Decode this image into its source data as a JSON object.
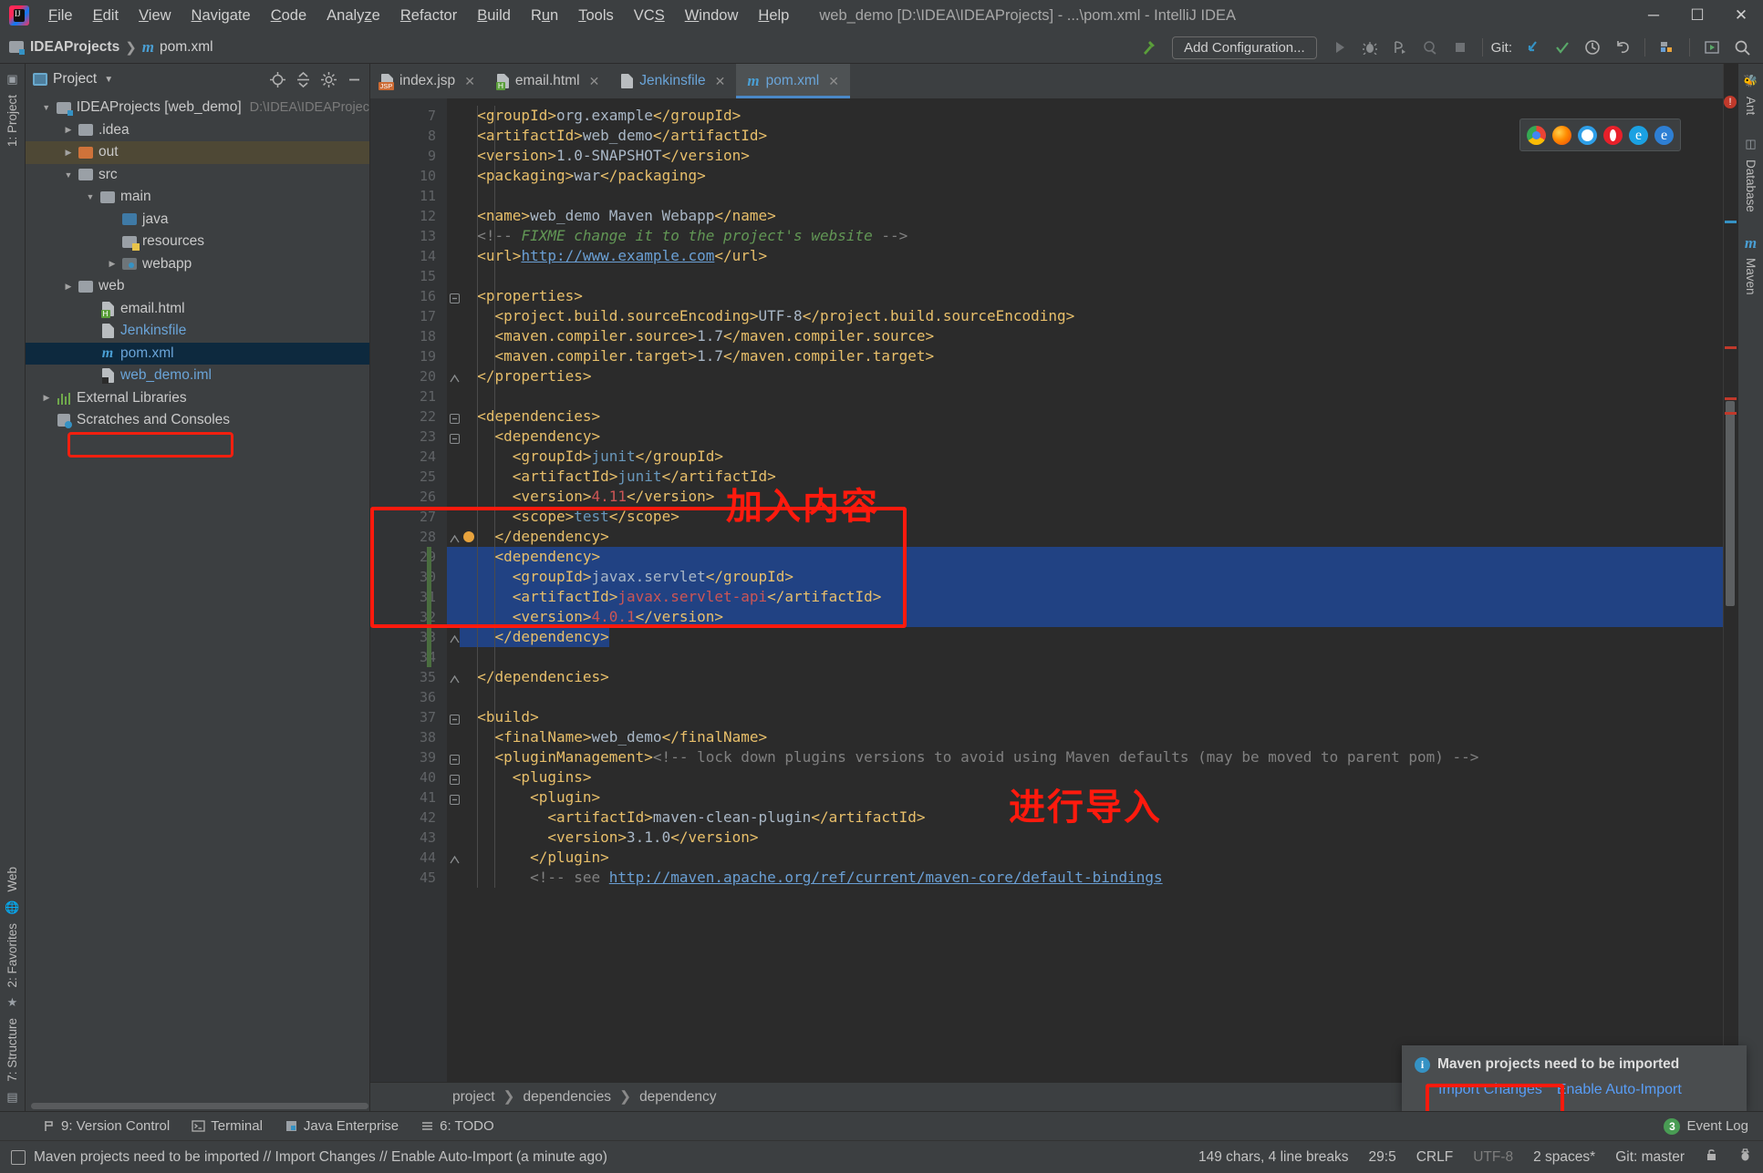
{
  "window": {
    "title": "web_demo [D:\\IDEA\\IDEAProjects] - ...\\pom.xml - IntelliJ IDEA",
    "minimize": "─",
    "maximize": "☐",
    "close": "✕"
  },
  "menu": [
    {
      "label": "File",
      "mnemonic": "F"
    },
    {
      "label": "Edit",
      "mnemonic": "E"
    },
    {
      "label": "View",
      "mnemonic": "V"
    },
    {
      "label": "Navigate",
      "mnemonic": "N"
    },
    {
      "label": "Code",
      "mnemonic": "C"
    },
    {
      "label": "Analyze",
      "mnemonic": "z"
    },
    {
      "label": "Refactor",
      "mnemonic": "R"
    },
    {
      "label": "Build",
      "mnemonic": "B"
    },
    {
      "label": "Run",
      "mnemonic": "u"
    },
    {
      "label": "Tools",
      "mnemonic": "T"
    },
    {
      "label": "VCS",
      "mnemonic": "S"
    },
    {
      "label": "Window",
      "mnemonic": "W"
    },
    {
      "label": "Help",
      "mnemonic": "H"
    }
  ],
  "navbar": {
    "crumb_project": "IDEAProjects",
    "crumb_file": "pom.xml",
    "add_configuration": "Add Configuration...",
    "git_label": "Git:"
  },
  "project_panel": {
    "title": "Project",
    "tree": [
      {
        "label": "IDEAProjects [web_demo]",
        "path": "D:\\IDEA\\IDEAProjec",
        "indent": 0,
        "arrow": "▼",
        "icon": "folder-root",
        "state": "normal"
      },
      {
        "label": ".idea",
        "path": "",
        "indent": 1,
        "arrow": "▶",
        "icon": "folder",
        "state": "normal"
      },
      {
        "label": "out",
        "path": "",
        "indent": 1,
        "arrow": "▶",
        "icon": "folder-orange",
        "state": "highlight"
      },
      {
        "label": "src",
        "path": "",
        "indent": 1,
        "arrow": "▼",
        "icon": "folder",
        "state": "normal"
      },
      {
        "label": "main",
        "path": "",
        "indent": 2,
        "arrow": "▼",
        "icon": "folder",
        "state": "normal"
      },
      {
        "label": "java",
        "path": "",
        "indent": 3,
        "arrow": "",
        "icon": "folder-blue",
        "state": "normal"
      },
      {
        "label": "resources",
        "path": "",
        "indent": 3,
        "arrow": "",
        "icon": "folder-resources",
        "state": "normal"
      },
      {
        "label": "webapp",
        "path": "",
        "indent": 3,
        "arrow": "▶",
        "icon": "folder-webapp",
        "state": "normal"
      },
      {
        "label": "web",
        "path": "",
        "indent": 1,
        "arrow": "▶",
        "icon": "folder",
        "state": "normal"
      },
      {
        "label": "email.html",
        "path": "",
        "indent": 2,
        "arrow": "",
        "icon": "file-html",
        "state": "normal"
      },
      {
        "label": "Jenkinsfile",
        "path": "",
        "indent": 2,
        "arrow": "",
        "icon": "file-jenkins",
        "state": "blue"
      },
      {
        "label": "pom.xml",
        "path": "",
        "indent": 2,
        "arrow": "",
        "icon": "file-maven",
        "state": "selected"
      },
      {
        "label": "web_demo.iml",
        "path": "",
        "indent": 2,
        "arrow": "",
        "icon": "file-iml",
        "state": "blue"
      },
      {
        "label": "External Libraries",
        "path": "",
        "indent": 0,
        "arrow": "▶",
        "icon": "libraries",
        "state": "normal"
      },
      {
        "label": "Scratches and Consoles",
        "path": "",
        "indent": 0,
        "arrow": "",
        "icon": "scratches",
        "state": "normal"
      }
    ]
  },
  "left_strip": {
    "project": "1: Project",
    "web": "Web",
    "favorites": "2: Favorites",
    "structure": "7: Structure"
  },
  "right_strip": {
    "ant": "Ant",
    "database": "Database",
    "maven": "Maven"
  },
  "tabs": [
    {
      "label": "index.jsp",
      "icon": "jsp-icon",
      "active": false
    },
    {
      "label": "email.html",
      "icon": "html-icon",
      "active": false
    },
    {
      "label": "Jenkinsfile",
      "icon": "jenkins-icon",
      "active": false
    },
    {
      "label": "pom.xml",
      "icon": "maven-icon",
      "active": true
    }
  ],
  "code": {
    "first_line": 7,
    "lines": [
      {
        "n": 7,
        "html": "  <span class='tg'>&lt;groupId&gt;</span><span class='tx'>org.example</span><span class='tg'>&lt;/groupId&gt;</span>"
      },
      {
        "n": 8,
        "html": "  <span class='tg'>&lt;artifactId&gt;</span><span class='tx'>web_demo</span><span class='tg'>&lt;/artifactId&gt;</span>"
      },
      {
        "n": 9,
        "html": "  <span class='tg'>&lt;version&gt;</span><span class='tx'>1.0-SNAPSHOT</span><span class='tg'>&lt;/version&gt;</span>"
      },
      {
        "n": 10,
        "html": "  <span class='tg'>&lt;packaging&gt;</span><span class='tx'>war</span><span class='tg'>&lt;/packaging&gt;</span>"
      },
      {
        "n": 11,
        "html": ""
      },
      {
        "n": 12,
        "html": "  <span class='tg'>&lt;name&gt;</span><span class='tx'>web_demo Maven Webapp</span><span class='tg'>&lt;/name&gt;</span>"
      },
      {
        "n": 13,
        "html": "  <span class='cm2'>&lt;!-- </span><span class='cm'>FIXME change it to the project's website </span><span class='cm2'>--&gt;</span>"
      },
      {
        "n": 14,
        "html": "  <span class='tg'>&lt;url&gt;</span><span class='lnk'>http://www.example.com</span><span class='tg'>&lt;/url&gt;</span>"
      },
      {
        "n": 15,
        "html": ""
      },
      {
        "n": 16,
        "html": "  <span class='tg'>&lt;properties&gt;</span>",
        "fold": "minus"
      },
      {
        "n": 17,
        "html": "    <span class='tg'>&lt;project.build.sourceEncoding&gt;</span><span class='tx'>UTF-8</span><span class='tg'>&lt;/project.build.sourceEncoding&gt;</span>"
      },
      {
        "n": 18,
        "html": "    <span class='tg'>&lt;maven.compiler.source&gt;</span><span class='tx'>1.7</span><span class='tg'>&lt;/maven.compiler.source&gt;</span>"
      },
      {
        "n": 19,
        "html": "    <span class='tg'>&lt;maven.compiler.target&gt;</span><span class='tx'>1.7</span><span class='tg'>&lt;/maven.compiler.target&gt;</span>"
      },
      {
        "n": 20,
        "html": "  <span class='tg'>&lt;/properties&gt;</span>",
        "fold": "end"
      },
      {
        "n": 21,
        "html": ""
      },
      {
        "n": 22,
        "html": "  <span class='tg'>&lt;dependencies&gt;</span>",
        "fold": "minus"
      },
      {
        "n": 23,
        "html": "    <span class='tg'>&lt;dependency&gt;</span>",
        "fold": "minus"
      },
      {
        "n": 24,
        "html": "      <span class='tg'>&lt;groupId&gt;</span><span class='val-blue'>junit</span><span class='tg'>&lt;/groupId&gt;</span>"
      },
      {
        "n": 25,
        "html": "      <span class='tg'>&lt;artifactId&gt;</span><span class='val-blue'>junit</span><span class='tg'>&lt;/artifactId&gt;</span>"
      },
      {
        "n": 26,
        "html": "      <span class='tg'>&lt;version&gt;</span><span class='val-red'>4.11</span><span class='tg'>&lt;/version&gt;</span>"
      },
      {
        "n": 27,
        "html": "      <span class='tg'>&lt;scope&gt;</span><span class='val-blue'>test</span><span class='tg'>&lt;/scope&gt;</span>"
      },
      {
        "n": 28,
        "html": "    <span class='tg'>&lt;/dependency&gt;</span>",
        "fold": "end",
        "bulb": true
      },
      {
        "n": 29,
        "html": "    <span class='tg'>&lt;dependency&gt;</span>",
        "fold": "minus",
        "select": "full",
        "changed": true
      },
      {
        "n": 30,
        "html": "      <span class='tg'>&lt;groupId&gt;</span><span class='tx'>javax.servlet</span><span class='tg'>&lt;/groupId&gt;</span>",
        "select": "full",
        "changed": true
      },
      {
        "n": 31,
        "html": "      <span class='tg'>&lt;artifactId&gt;</span><span class='val-red'>javax.servlet-api</span><span class='tg'>&lt;/artifactId&gt;</span>",
        "select": "full",
        "changed": true
      },
      {
        "n": 32,
        "html": "      <span class='tg'>&lt;version&gt;</span><span class='val-red'>4.0.1</span><span class='tg'>&lt;/version&gt;</span>",
        "select": "full",
        "changed": true
      },
      {
        "n": 33,
        "html": "    <span class='tg'>&lt;/dependency&gt;</span>",
        "fold": "end",
        "select": "partial",
        "select_width": 198,
        "changed": true
      },
      {
        "n": 34,
        "html": "",
        "changed": true
      },
      {
        "n": 35,
        "html": "  <span class='tg'>&lt;/dependencies&gt;</span>",
        "fold": "end"
      },
      {
        "n": 36,
        "html": ""
      },
      {
        "n": 37,
        "html": "  <span class='tg'>&lt;build&gt;</span>",
        "fold": "minus"
      },
      {
        "n": 38,
        "html": "    <span class='tg'>&lt;finalName&gt;</span><span class='tx'>web_demo</span><span class='tg'>&lt;/finalName&gt;</span>"
      },
      {
        "n": 39,
        "html": "    <span class='tg'>&lt;pluginManagement&gt;</span><span class='cm2'>&lt;!-- lock down plugins versions to avoid using Maven defaults (may be moved to parent pom) --&gt;</span>",
        "fold": "minus"
      },
      {
        "n": 40,
        "html": "      <span class='tg'>&lt;plugins&gt;</span>",
        "fold": "minus"
      },
      {
        "n": 41,
        "html": "        <span class='tg'>&lt;plugin&gt;</span>",
        "fold": "minus"
      },
      {
        "n": 42,
        "html": "          <span class='tg'>&lt;artifactId&gt;</span><span class='tx'>maven-clean-plugin</span><span class='tg'>&lt;/artifactId&gt;</span>"
      },
      {
        "n": 43,
        "html": "          <span class='tg'>&lt;version&gt;</span><span class='tx'>3.1.0</span><span class='tg'>&lt;/version&gt;</span>"
      },
      {
        "n": 44,
        "html": "        <span class='tg'>&lt;/plugin&gt;</span>",
        "fold": "end"
      },
      {
        "n": 45,
        "html": "        <span class='cm2'>&lt;!-- see </span><span class='lnk'>http://maven.apache.org/ref/current/maven-core/default-bindings</span>"
      }
    ]
  },
  "annotations": {
    "add_content": "加入内容",
    "do_import": "进行导入"
  },
  "breadcrumb": [
    "project",
    "dependencies",
    "dependency"
  ],
  "notification": {
    "message": "Maven projects need to be imported",
    "import_changes": "Import Changes",
    "enable_auto_import": "Enable Auto-Import",
    "info_glyph": "i"
  },
  "tool_windows": [
    {
      "label": "9: Version Control",
      "mnemonic": "9",
      "icon": "vcs-icon"
    },
    {
      "label": "Terminal",
      "mnemonic": "",
      "icon": "terminal-icon"
    },
    {
      "label": "Java Enterprise",
      "mnemonic": "",
      "icon": "java-ee-icon"
    },
    {
      "label": "6: TODO",
      "mnemonic": "6",
      "icon": "todo-icon"
    }
  ],
  "event_log": {
    "label": "Event Log",
    "count": "3"
  },
  "statusbar": {
    "message": "Maven projects need to be imported // Import Changes // Enable Auto-Import (a minute ago)",
    "chars": "149 chars, 4 line breaks",
    "caret": "29:5",
    "line_sep": "CRLF",
    "encoding": "UTF-8",
    "indent": "2 spaces*",
    "git_branch": "Git: master"
  },
  "colors": {
    "accent_blue": "#4a88c7",
    "selection_blue": "#214283",
    "annotation_red": "#ff1a0d",
    "tag_yellow": "#e8bf6a",
    "comment_green": "#629755",
    "link_blue": "#589df6"
  }
}
